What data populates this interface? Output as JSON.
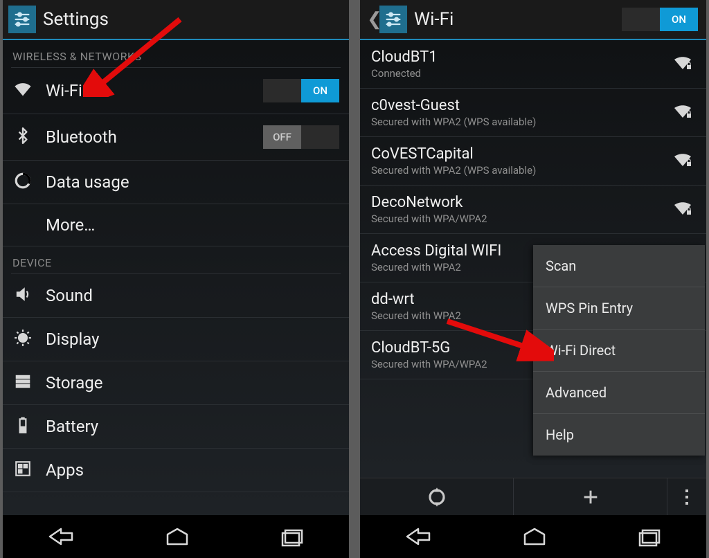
{
  "left": {
    "title": "Settings",
    "section1": "WIRELESS & NETWORKS",
    "section2": "DEVICE",
    "items": {
      "wifi": "Wi-Fi",
      "bluetooth": "Bluetooth",
      "data": "Data usage",
      "more": "More…",
      "sound": "Sound",
      "display": "Display",
      "storage": "Storage",
      "battery": "Battery",
      "apps": "Apps"
    },
    "on_label": "ON",
    "off_label": "OFF"
  },
  "right": {
    "title": "Wi-Fi",
    "on_label": "ON",
    "networks": [
      {
        "name": "CloudBT1",
        "sub": "Connected",
        "lock": true
      },
      {
        "name": "c0vest-Guest",
        "sub": "Secured with WPA2 (WPS available)",
        "lock": true
      },
      {
        "name": "CoVESTCapital",
        "sub": "Secured with WPA2 (WPS available)",
        "lock": true
      },
      {
        "name": "DecoNetwork",
        "sub": "Secured with WPA/WPA2",
        "lock": true
      },
      {
        "name": "Access Digital WIFI",
        "sub": "Secured with WPA2",
        "lock": true
      },
      {
        "name": "dd-wrt",
        "sub": "Secured with WPA2",
        "lock": true
      },
      {
        "name": "CloudBT-5G",
        "sub": "Secured with WPA/WPA2",
        "lock": true
      }
    ],
    "menu": [
      "Scan",
      "WPS Pin Entry",
      "Wi-Fi Direct",
      "Advanced",
      "Help"
    ]
  }
}
